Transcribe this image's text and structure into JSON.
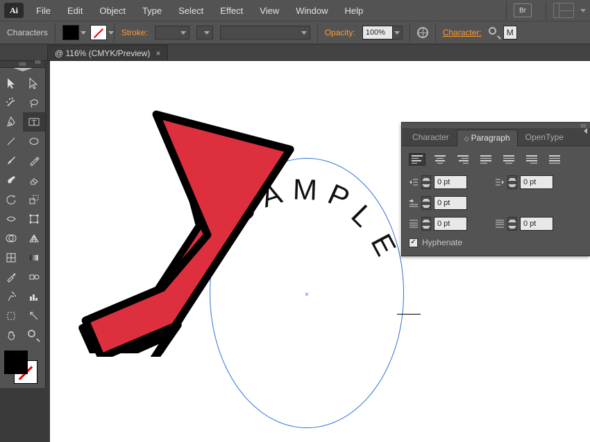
{
  "app": {
    "logo": "Ai"
  },
  "menu": [
    "File",
    "Edit",
    "Object",
    "Type",
    "Select",
    "Effect",
    "View",
    "Window",
    "Help"
  ],
  "br_badge": "Br",
  "controlbar": {
    "label": "Characters",
    "stroke_label": "Stroke:",
    "opacity_label": "Opacity:",
    "opacity_value": "100%",
    "character_link": "Character:",
    "font_field_prefix": "M"
  },
  "document": {
    "tab_title": "@ 116% (CMYK/Preview)",
    "close_glyph": "×"
  },
  "canvas": {
    "sample_text": "SAMPLE"
  },
  "panel": {
    "tabs": {
      "character": "Character",
      "paragraph": "Paragraph",
      "opentype": "OpenType"
    },
    "indent_left": "0 pt",
    "indent_right": "0 pt",
    "first_line": "0 pt",
    "space_before": "0 pt",
    "space_after": "0 pt",
    "hyphenate_label": "Hyphenate",
    "hyphenate_check": "✓"
  },
  "tools": {
    "icons": [
      [
        "selection",
        "direct-selection"
      ],
      [
        "magic-wand",
        "lasso"
      ],
      [
        "pen",
        "type"
      ],
      [
        "line-segment",
        "rectangle"
      ],
      [
        "paintbrush",
        "pencil"
      ],
      [
        "blob-brush",
        "eraser"
      ],
      [
        "rotate",
        "scale"
      ],
      [
        "width",
        "free-transform"
      ],
      [
        "shape-builder",
        "perspective-grid"
      ],
      [
        "mesh",
        "gradient"
      ],
      [
        "eyedropper",
        "blend"
      ],
      [
        "symbol-sprayer",
        "column-graph"
      ],
      [
        "artboard",
        "slice"
      ],
      [
        "hand",
        "zoom"
      ]
    ]
  }
}
